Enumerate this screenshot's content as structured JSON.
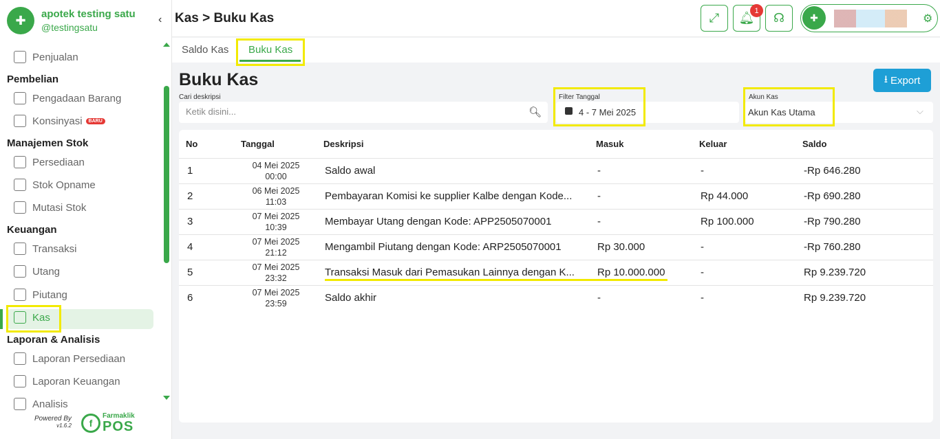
{
  "sidebar": {
    "store_name": "apotek testing satu",
    "store_handle": "@testingsatu",
    "collapse_icon": "‹",
    "items": [
      {
        "type": "item",
        "label": "Penjualan",
        "icon": "basket-icon"
      },
      {
        "type": "heading",
        "label": "Pembelian"
      },
      {
        "type": "item",
        "label": "Pengadaan Barang",
        "icon": "box-icon"
      },
      {
        "type": "item",
        "label": "Konsinyasi",
        "icon": "box-icon",
        "badge": "BARU"
      },
      {
        "type": "heading",
        "label": "Manajemen Stok"
      },
      {
        "type": "item",
        "label": "Persediaan",
        "icon": "box-icon"
      },
      {
        "type": "item",
        "label": "Stok Opname",
        "icon": "box-icon"
      },
      {
        "type": "item",
        "label": "Mutasi Stok",
        "icon": "box-icon"
      },
      {
        "type": "heading",
        "label": "Keuangan"
      },
      {
        "type": "item",
        "label": "Transaksi",
        "icon": "exchange-icon"
      },
      {
        "type": "item",
        "label": "Utang",
        "icon": "receipt-icon"
      },
      {
        "type": "item",
        "label": "Piutang",
        "icon": "receipt-icon"
      },
      {
        "type": "item",
        "label": "Kas",
        "icon": "cash-icon",
        "active": true
      },
      {
        "type": "heading",
        "label": "Laporan & Analisis"
      },
      {
        "type": "item",
        "label": "Laporan Persediaan",
        "icon": "clipboard-icon"
      },
      {
        "type": "item",
        "label": "Laporan Keuangan",
        "icon": "clipboard-icon"
      },
      {
        "type": "item",
        "label": "Analisis",
        "icon": "chart-icon"
      }
    ],
    "powered_by": "Powered By",
    "version": "v1.6.2",
    "brand_top": "Farmaklik",
    "brand_bottom": "POS"
  },
  "header": {
    "breadcrumb": "Kas > Buku Kas",
    "notification_count": "1"
  },
  "tabs": [
    {
      "label": "Saldo Kas",
      "active": false
    },
    {
      "label": "Buku Kas",
      "active": true
    }
  ],
  "page": {
    "title": "Buku Kas",
    "export_label": "Export",
    "search_label": "Cari deskripsi",
    "search_placeholder": "Ketik disini...",
    "date_label": "Filter Tanggal",
    "date_value": "4 - 7 Mei 2025",
    "account_label": "Akun Kas",
    "account_value": "Akun Kas Utama"
  },
  "table": {
    "headers": [
      "No",
      "Tanggal",
      "Deskripsi",
      "Masuk",
      "Keluar",
      "Saldo"
    ],
    "rows": [
      {
        "no": "1",
        "date": "04 Mei 2025",
        "time": "00:00",
        "desc": "Saldo awal",
        "in": "-",
        "out": "-",
        "balance": "-Rp 646.280"
      },
      {
        "no": "2",
        "date": "06 Mei 2025",
        "time": "11:03",
        "desc": "Pembayaran Komisi ke supplier Kalbe dengan Kode...",
        "in": "-",
        "out": "Rp 44.000",
        "balance": "-Rp 690.280"
      },
      {
        "no": "3",
        "date": "07 Mei 2025",
        "time": "10:39",
        "desc": "Membayar Utang dengan Kode: APP2505070001",
        "in": "-",
        "out": "Rp 100.000",
        "balance": "-Rp 790.280"
      },
      {
        "no": "4",
        "date": "07 Mei 2025",
        "time": "21:12",
        "desc": "Mengambil Piutang dengan Kode: ARP2505070001",
        "in": "Rp 30.000",
        "out": "-",
        "balance": "-Rp 760.280"
      },
      {
        "no": "5",
        "date": "07 Mei 2025",
        "time": "23:32",
        "desc": "Transaksi Masuk dari Pemasukan Lainnya dengan K...",
        "in": "Rp 10.000.000",
        "out": "-",
        "balance": "Rp 9.239.720"
      },
      {
        "no": "6",
        "date": "07 Mei 2025",
        "time": "23:59",
        "desc": "Saldo akhir",
        "in": "-",
        "out": "-",
        "balance": "Rp 9.239.720"
      }
    ]
  },
  "colors": {
    "brand": "#3aa84a",
    "export": "#1e9fd6",
    "highlight": "#f2ea00",
    "notif": "#e53935"
  }
}
